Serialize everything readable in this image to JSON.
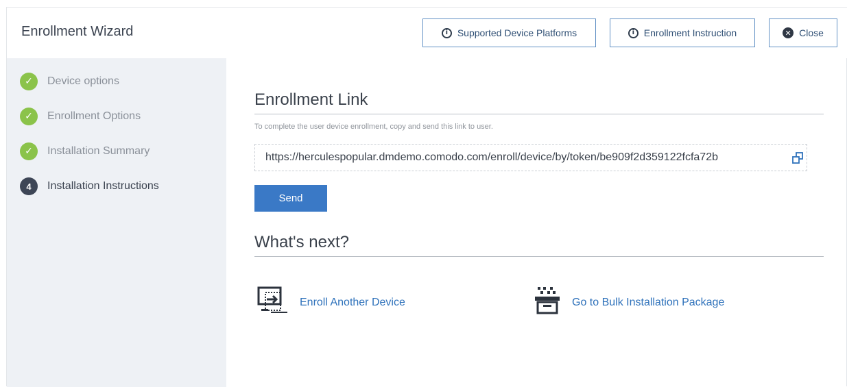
{
  "header": {
    "title": "Enrollment Wizard",
    "buttons": {
      "platforms": "Supported Device Platforms",
      "instruction": "Enrollment Instruction",
      "close": "Close"
    }
  },
  "sidebar": {
    "steps": [
      {
        "label": "Device options",
        "status": "done"
      },
      {
        "label": "Enrollment Options",
        "status": "done"
      },
      {
        "label": "Installation Summary",
        "status": "done"
      },
      {
        "label": "Installation Instructions",
        "status": "current",
        "number": "4"
      }
    ]
  },
  "main": {
    "section_title": "Enrollment Link",
    "note": "To complete the user device enrollment, copy and send this link to user.",
    "link": "https://herculespopular.dmdemo.comodo.com/enroll/device/by/token/be909f2d359122fcfa72b",
    "send_label": "Send",
    "next_title": "What's next?",
    "actions": {
      "enroll_another": "Enroll Another Device",
      "bulk_package": "Go to Bulk Installation Package"
    }
  },
  "colors": {
    "accent": "#3a79c6",
    "step_done": "#8bc34a",
    "sidebar_bg": "#eef1f5"
  },
  "icons": [
    "info-icon",
    "close-icon",
    "check-icon",
    "copy-icon",
    "enroll-device-icon",
    "bulk-package-icon"
  ]
}
